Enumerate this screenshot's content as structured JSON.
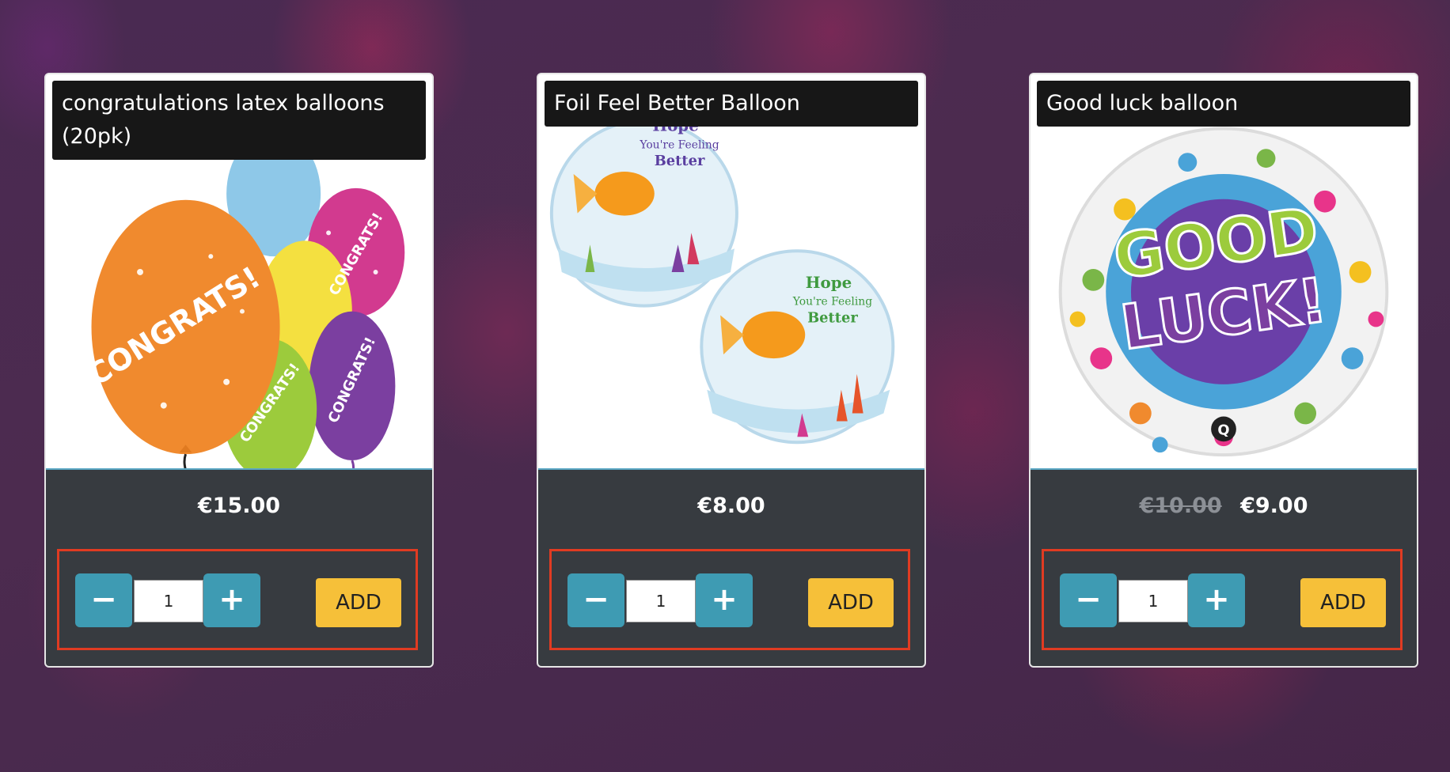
{
  "products": [
    {
      "title": "congratulations latex balloons (20pk)",
      "price": "€15.00",
      "old_price": "",
      "quantity": "1",
      "minus_label": "−",
      "plus_label": "+",
      "add_label": "ADD",
      "image_text": "CONGRATS!"
    },
    {
      "title": "Foil Feel Better Balloon",
      "price": "€8.00",
      "old_price": "",
      "quantity": "1",
      "minus_label": "−",
      "plus_label": "+",
      "add_label": "ADD",
      "image_text_1": "Hope",
      "image_text_2": "You're Feeling",
      "image_text_3": "Better"
    },
    {
      "title": "Good luck balloon",
      "price": "€9.00",
      "old_price": "€10.00",
      "quantity": "1",
      "minus_label": "−",
      "plus_label": "+",
      "add_label": "ADD",
      "image_text_1": "GOOD",
      "image_text_2": "LUCK!",
      "image_text_3": "Q"
    }
  ],
  "colors": {
    "button_blue": "#3e9bb3",
    "add_yellow": "#f6c039",
    "panel_dark": "#373b40",
    "highlight_red": "#e03b22"
  }
}
